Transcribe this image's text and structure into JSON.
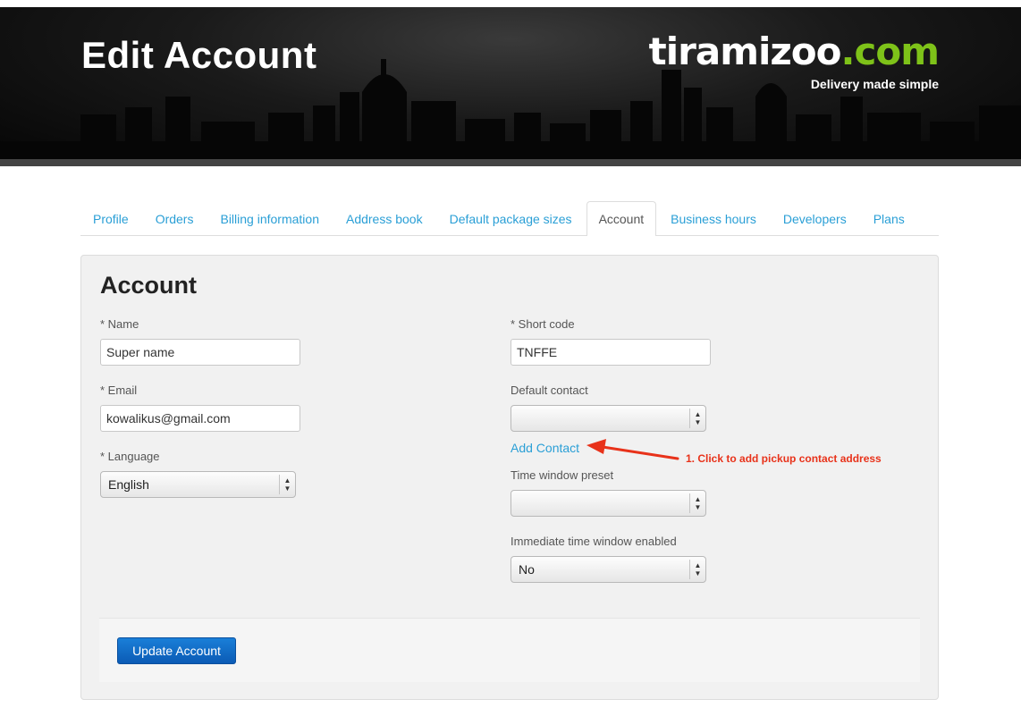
{
  "header": {
    "title": "Edit Account",
    "brand_main": "tiramizoo",
    "brand_tld": ".com",
    "tagline": "Delivery made simple"
  },
  "tabs": [
    {
      "label": "Profile",
      "active": false
    },
    {
      "label": "Orders",
      "active": false
    },
    {
      "label": "Billing information",
      "active": false
    },
    {
      "label": "Address book",
      "active": false
    },
    {
      "label": "Default package sizes",
      "active": false
    },
    {
      "label": "Account",
      "active": true
    },
    {
      "label": "Business hours",
      "active": false
    },
    {
      "label": "Developers",
      "active": false
    },
    {
      "label": "Plans",
      "active": false
    }
  ],
  "form": {
    "title": "Account",
    "name": {
      "label": "* Name",
      "value": "Super name"
    },
    "email": {
      "label": "* Email",
      "value": "kowalikus@gmail.com"
    },
    "language": {
      "label": "* Language",
      "value": "English"
    },
    "short_code": {
      "label": "* Short code",
      "value": "TNFFE"
    },
    "default_contact": {
      "label": "Default contact",
      "value": ""
    },
    "add_contact_link": "Add Contact",
    "time_window_preset": {
      "label": "Time window preset",
      "value": ""
    },
    "immediate_time_window": {
      "label": "Immediate time window enabled",
      "value": "No"
    },
    "submit_label": "Update Account"
  },
  "annotation": {
    "text": "1. Click to add pickup contact address",
    "color": "#e8321a"
  },
  "colors": {
    "link": "#2a9fd6",
    "brand_accent": "#7ec219",
    "primary_button": "#1a7fd8"
  }
}
